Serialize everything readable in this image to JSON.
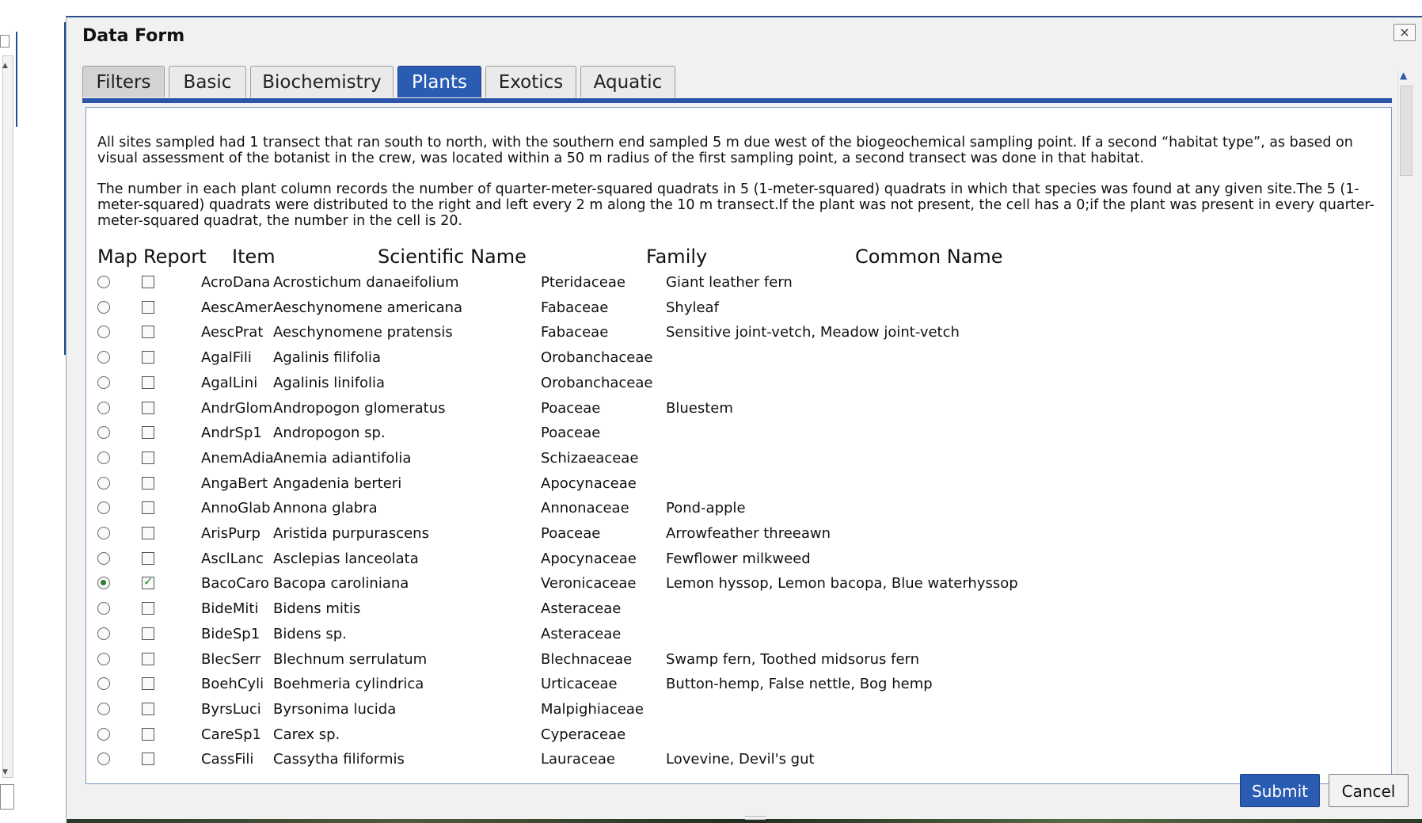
{
  "dialog": {
    "title": "Data Form",
    "close_label": "×",
    "tabs": [
      {
        "label": "Filters"
      },
      {
        "label": "Basic"
      },
      {
        "label": "Biochemistry"
      },
      {
        "label": "Plants"
      },
      {
        "label": "Exotics"
      },
      {
        "label": "Aquatic"
      }
    ],
    "active_tab": "Plants",
    "description": [
      "All sites sampled had 1 transect that ran south to north, with the southern end sampled 5 m due west of the biogeochemical sampling point. If a second “habitat type”, as based on visual assessment of the botanist in the crew, was located within a 50 m radius of the first sampling point, a second transect was done in that habitat.",
      "The number in each plant column records the number of quarter-meter-squared quadrats in 5 (1-meter-squared) quadrats in which that species was found at any given site.The 5 (1-meter-squared) quadrats were distributed to the right and left every 2 m along the 10 m transect.If the plant was not present, the cell has a 0;if the plant was present in every quarter-meter-squared quadrat, the number in the cell is 20."
    ],
    "table": {
      "headers": {
        "map": "Map",
        "report": "Report",
        "item": "Item",
        "sci": "Scientific Name",
        "family": "Family",
        "common": "Common Name"
      },
      "rows": [
        {
          "item": "AcroDana",
          "sci": "Acrostichum danaeifolium",
          "family": "Pteridaceae",
          "common": "Giant leather fern",
          "map": false,
          "report": false
        },
        {
          "item": "AescAmer",
          "sci": "Aeschynomene americana",
          "family": "Fabaceae",
          "common": "Shyleaf",
          "map": false,
          "report": false
        },
        {
          "item": "AescPrat",
          "sci": "Aeschynomene pratensis",
          "family": "Fabaceae",
          "common": "Sensitive joint-vetch, Meadow joint-vetch",
          "map": false,
          "report": false
        },
        {
          "item": "AgalFili",
          "sci": "Agalinis filifolia",
          "family": "Orobanchaceae",
          "common": "",
          "map": false,
          "report": false
        },
        {
          "item": "AgalLini",
          "sci": "Agalinis linifolia",
          "family": "Orobanchaceae",
          "common": "",
          "map": false,
          "report": false
        },
        {
          "item": "AndrGlom",
          "sci": "Andropogon glomeratus",
          "family": "Poaceae",
          "common": "Bluestem",
          "map": false,
          "report": false
        },
        {
          "item": "AndrSp1",
          "sci": "Andropogon sp.",
          "family": "Poaceae",
          "common": "",
          "map": false,
          "report": false
        },
        {
          "item": "AnemAdia",
          "sci": "Anemia adiantifolia",
          "family": "Schizaeaceae",
          "common": "",
          "map": false,
          "report": false
        },
        {
          "item": "AngaBert",
          "sci": "Angadenia berteri",
          "family": "Apocynaceae",
          "common": "",
          "map": false,
          "report": false
        },
        {
          "item": "AnnoGlab",
          "sci": "Annona glabra",
          "family": "Annonaceae",
          "common": "Pond-apple",
          "map": false,
          "report": false
        },
        {
          "item": "ArisPurp",
          "sci": "Aristida purpurascens",
          "family": "Poaceae",
          "common": "Arrowfeather threeawn",
          "map": false,
          "report": false
        },
        {
          "item": "AsclLanc",
          "sci": "Asclepias lanceolata",
          "family": "Apocynaceae",
          "common": "Fewflower milkweed",
          "map": false,
          "report": false
        },
        {
          "item": "BacoCaro",
          "sci": "Bacopa caroliniana",
          "family": "Veronicaceae",
          "common": "Lemon hyssop, Lemon bacopa, Blue waterhyssop",
          "map": true,
          "report": true
        },
        {
          "item": "BideMiti",
          "sci": "Bidens mitis",
          "family": "Asteraceae",
          "common": "",
          "map": false,
          "report": false
        },
        {
          "item": "BideSp1",
          "sci": "Bidens sp.",
          "family": "Asteraceae",
          "common": "",
          "map": false,
          "report": false
        },
        {
          "item": "BlecSerr",
          "sci": "Blechnum serrulatum",
          "family": "Blechnaceae",
          "common": "Swamp fern, Toothed midsorus fern",
          "map": false,
          "report": false
        },
        {
          "item": "BoehCyli",
          "sci": "Boehmeria cylindrica",
          "family": "Urticaceae",
          "common": "Button-hemp, False nettle, Bog hemp",
          "map": false,
          "report": false
        },
        {
          "item": "ByrsLuci",
          "sci": "Byrsonima lucida",
          "family": "Malpighiaceae",
          "common": "",
          "map": false,
          "report": false
        },
        {
          "item": "CareSp1",
          "sci": "Carex sp.",
          "family": "Cyperaceae",
          "common": "",
          "map": false,
          "report": false
        },
        {
          "item": "CassFili",
          "sci": "Cassytha filiformis",
          "family": "Lauraceae",
          "common": "Lovevine, Devil's gut",
          "map": false,
          "report": false
        }
      ]
    },
    "buttons": {
      "submit": "Submit",
      "cancel": "Cancel"
    }
  }
}
